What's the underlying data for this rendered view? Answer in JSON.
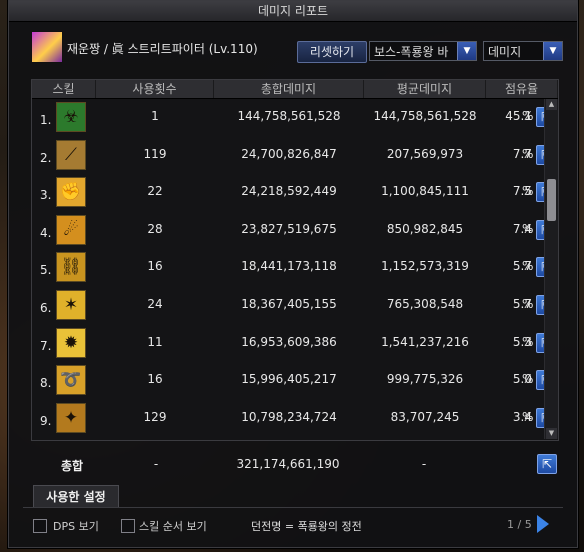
{
  "window": {
    "title": "데미지 리포트"
  },
  "header": {
    "char_name": "재운짱 / 眞 스트리트파이터 (Lv.110)",
    "reset_label": "리셋하기",
    "boss_select": "보스-폭룡왕 바",
    "type_select": "데미지"
  },
  "columns": {
    "skill": "스킬",
    "uses": "사용횟수",
    "total": "총합데미지",
    "avg": "평균데미지",
    "share": "점유율"
  },
  "rows": [
    {
      "idx": "1.",
      "uses": "1",
      "total": "144,758,561,528",
      "avg": "144,758,561,528",
      "share": "45.1",
      "pct": "%",
      "icon_color": "#2c7a2c",
      "icon": "skill-poison-icon"
    },
    {
      "idx": "2.",
      "uses": "119",
      "total": "24,700,826,847",
      "avg": "207,569,973",
      "share": "7.7",
      "pct": "%",
      "icon_color": "#a57b32",
      "icon": "skill-slash-icon"
    },
    {
      "idx": "3.",
      "uses": "22",
      "total": "24,218,592,449",
      "avg": "1,100,845,111",
      "share": "7.5",
      "pct": "%",
      "icon_color": "#e3a72e",
      "icon": "skill-punch-icon"
    },
    {
      "idx": "4.",
      "uses": "28",
      "total": "23,827,519,675",
      "avg": "850,982,845",
      "share": "7.4",
      "pct": "%",
      "icon_color": "#d48f1e",
      "icon": "skill-kick-icon"
    },
    {
      "idx": "5.",
      "uses": "16",
      "total": "18,441,173,118",
      "avg": "1,152,573,319",
      "share": "5.7",
      "pct": "%",
      "icon_color": "#c9941f",
      "icon": "skill-chain-icon"
    },
    {
      "idx": "6.",
      "uses": "24",
      "total": "18,367,405,155",
      "avg": "765,308,548",
      "share": "5.7",
      "pct": "%",
      "icon_color": "#e0b12a",
      "icon": "skill-spark-icon"
    },
    {
      "idx": "7.",
      "uses": "11",
      "total": "16,953,609,386",
      "avg": "1,541,237,216",
      "share": "5.3",
      "pct": "%",
      "icon_color": "#e9c138",
      "icon": "skill-burst-icon"
    },
    {
      "idx": "8.",
      "uses": "16",
      "total": "15,996,405,217",
      "avg": "999,775,326",
      "share": "5.0",
      "pct": "%",
      "icon_color": "#d8a129",
      "icon": "skill-swirl-icon"
    },
    {
      "idx": "9.",
      "uses": "129",
      "total": "10,798,234,724",
      "avg": "83,707,245",
      "share": "3.4",
      "pct": "%",
      "icon_color": "#b37a1e",
      "icon": "skill-bomb-icon"
    }
  ],
  "totals": {
    "label": "총합",
    "uses": "-",
    "total": "321,174,661,190",
    "avg": "-"
  },
  "used_settings_tab": "사용한 설정",
  "footer": {
    "dps_label": "DPS 보기",
    "order_label": "스킬 순서 보기",
    "dungeon": "던전명 = 폭룡왕의 정전",
    "page": "1 / 5"
  },
  "icons": {
    "share": "share-icon",
    "caret": "chevron-down-icon"
  }
}
